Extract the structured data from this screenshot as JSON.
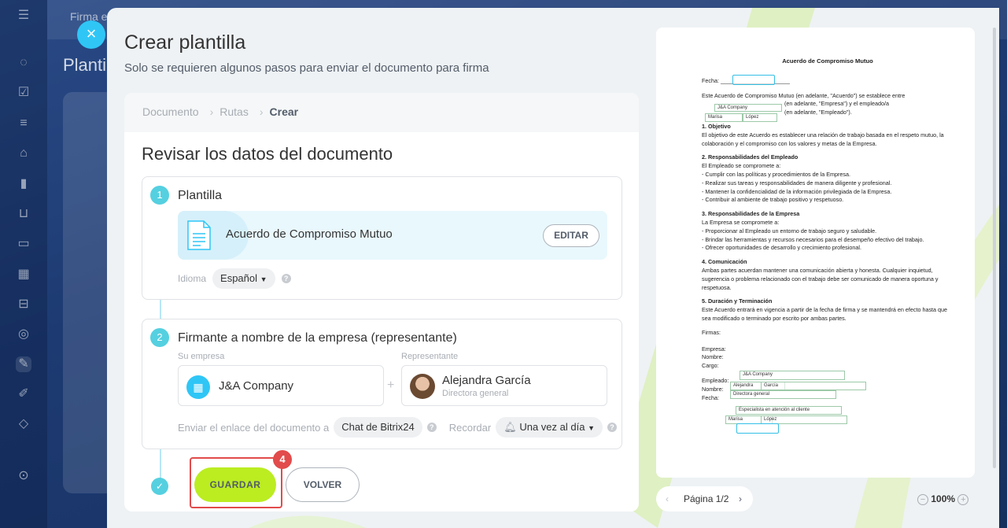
{
  "background": {
    "top_tab": "Firma e",
    "page_title": "Planti"
  },
  "slider": {
    "title": "Crear plantilla",
    "subtitle": "Solo se requieren algunos pasos para enviar el documento para firma"
  },
  "breadcrumb": {
    "items": [
      "Documento",
      "Rutas",
      "Crear"
    ]
  },
  "review": {
    "title": "Revisar los datos del documento",
    "step1": {
      "number": "1",
      "heading": "Plantilla",
      "template_name": "Acuerdo de Compromiso Mutuo",
      "edit_label": "EDITAR",
      "language_label": "Idioma",
      "language_value": "Español"
    },
    "step2": {
      "number": "2",
      "heading": "Firmante a nombre de la empresa (representante)",
      "company_label": "Su empresa",
      "company_name": "J&A Company",
      "rep_label": "Representante",
      "rep_name": "Alejandra García",
      "rep_role": "Directora general",
      "send_link_label": "Enviar el enlace del documento a",
      "send_link_value": "Chat de Bitrix24",
      "remind_label": "Recordar",
      "remind_value": "Una vez al día"
    }
  },
  "actions": {
    "save_label": "GUARDAR",
    "back_label": "VOLVER",
    "step_badge": "4"
  },
  "preview": {
    "doc_title": "Acuerdo de Compromiso Mutuo",
    "fecha_label": "Fecha:",
    "intro_1": "Este Acuerdo de Compromiso Mutuo (en adelante, \"Acuerdo\") se establece entre",
    "intro_2": "(en adelante, \"Empresa\") y el empleado/a",
    "intro_3": "(en adelante, \"Empleado\").",
    "field_company": "J&A Company",
    "field_emp_first": "Marisa",
    "field_emp_last": "López",
    "s1_title": "1. Objetivo",
    "s1_text": "El objetivo de este Acuerdo es establecer una relación de trabajo basada en el respeto mutuo, la colaboración y el compromiso con los valores y metas de la Empresa.",
    "s2_title": "2. Responsabilidades del Empleado",
    "s2_lines": [
      "El Empleado se compromete a:",
      "- Cumplir con las políticas y procedimientos de la Empresa.",
      "- Realizar sus tareas y responsabilidades de manera diligente y profesional.",
      "- Mantener la confidencialidad de la información privilegiada de la Empresa.",
      "- Contribuir al ambiente de trabajo positivo y respetuoso."
    ],
    "s3_title": "3. Responsabilidades de la Empresa",
    "s3_lines": [
      "La Empresa se compromete a:",
      "- Proporcionar al Empleado un entorno de trabajo seguro y saludable.",
      "- Brindar las herramientas y recursos necesarios para el desempeño efectivo del trabajo.",
      "- Ofrecer oportunidades de desarrollo y crecimiento profesional."
    ],
    "s4_title": "4. Comunicación",
    "s4_text": "Ambas partes acuerdan mantener una comunicación abierta y honesta. Cualquier inquietud, sugerencia o problema relacionado con el trabajo debe ser comunicado de manera oportuna y respetuosa.",
    "s5_title": "5. Duración y Terminación",
    "s5_text": "Este Acuerdo entrará en vigencia a partir de la fecha de firma y se mantendrá en efecto hasta que sea modificado o terminado por escrito por ambas partes.",
    "firmas_label": "Firmas:",
    "empresa_label": "Empresa:",
    "nombre_label": "Nombre:",
    "cargo_label": "Cargo:",
    "empleado_label": "Empleado:",
    "sig_company": "J&A Company",
    "sig_first": "Alejandra",
    "sig_last": "García",
    "sig_role": "Directora general",
    "sig_emp_role": "Especialista en atención al cliente",
    "sig_emp_first": "Marisa",
    "sig_emp_last": "López",
    "page_label": "Página 1/2",
    "zoom": "100%"
  },
  "colors": {
    "accent_blue": "#2fc6f6",
    "save_green": "#bbed21",
    "highlight_red": "#e24b4b",
    "step_teal": "#55d0e0"
  }
}
